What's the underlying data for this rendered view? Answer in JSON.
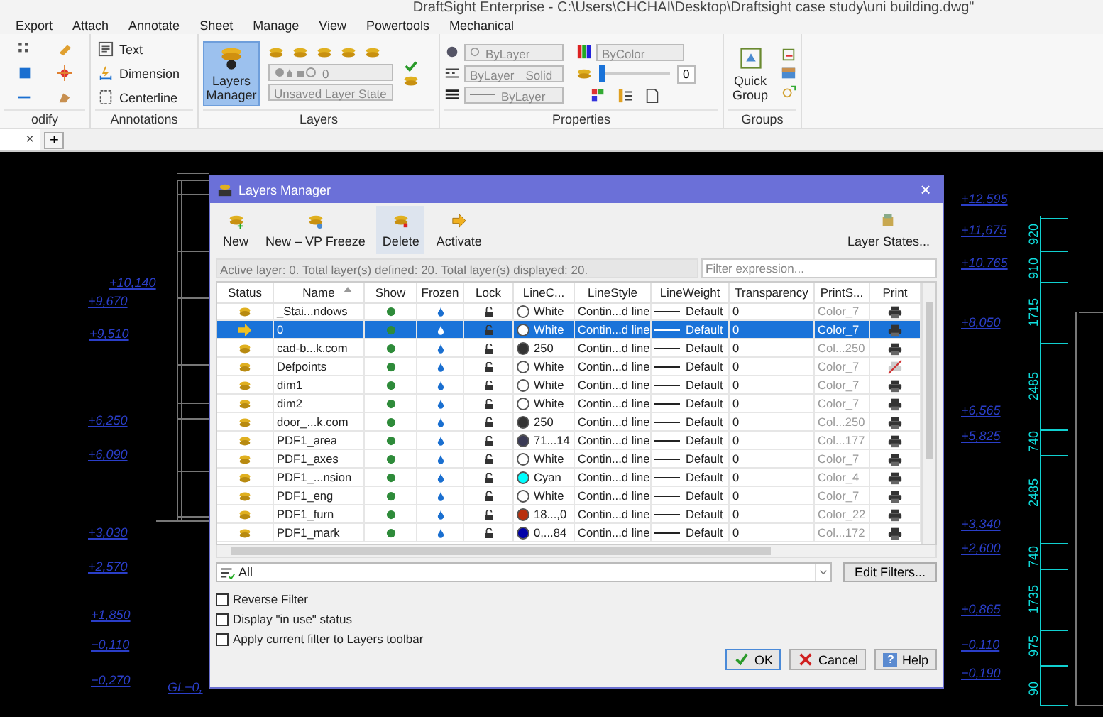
{
  "window": {
    "title": "DraftSight Enterprise - C:\\Users\\CHCHAI\\Desktop\\Draftsight case study\\uni building.dwg\""
  },
  "ribbon": {
    "tabs": [
      "Export",
      "Attach",
      "Annotate",
      "Sheet",
      "Manage",
      "View",
      "Powertools",
      "Mechanical"
    ],
    "modify": {
      "label": "odify"
    },
    "annotations": {
      "label": "Annotations",
      "items": [
        "Text",
        "Dimension",
        "Centerline"
      ]
    },
    "layers": {
      "label": "Layers",
      "manager_button": {
        "label": "Layers Manager",
        "active": true
      },
      "layer_combo": "0",
      "state_combo": "Unsaved Layer State"
    },
    "properties": {
      "label": "Properties",
      "color_combo": "ByLayer",
      "linestyle_combo": [
        "ByLayer",
        "Solid"
      ],
      "lineweight_combo": "ByLayer",
      "plotstyle_combo": "ByColor",
      "transparency": {
        "level": 0,
        "value": "0"
      }
    },
    "groups": {
      "label": "Groups",
      "quick_group": "Quick Group"
    }
  },
  "document_tabs": {
    "close": "×",
    "new": "+"
  },
  "canvas_labels": [
    {
      "text": "+10,140",
      "kind": "elevation"
    },
    {
      "text": "+9,670",
      "kind": "elevation"
    },
    {
      "text": "+9,510",
      "kind": "elevation"
    },
    {
      "text": "+6,250",
      "kind": "elevation"
    },
    {
      "text": "+6,090",
      "kind": "elevation"
    },
    {
      "text": "+3,030",
      "kind": "elevation"
    },
    {
      "text": "+2,570",
      "kind": "elevation"
    },
    {
      "text": "+1,850",
      "kind": "elevation"
    },
    {
      "text": "−0,110",
      "kind": "elevation"
    },
    {
      "text": "−0,270",
      "kind": "elevation"
    },
    {
      "text": "GL−0,",
      "kind": "elevation"
    },
    {
      "text": "+12,595",
      "kind": "elevation"
    },
    {
      "text": "+11,675",
      "kind": "elevation"
    },
    {
      "text": "+10,765",
      "kind": "elevation"
    },
    {
      "text": "+8,050",
      "kind": "elevation"
    },
    {
      "text": "+6,565",
      "kind": "elevation"
    },
    {
      "text": "+5,825",
      "kind": "elevation"
    },
    {
      "text": "+3,340",
      "kind": "elevation"
    },
    {
      "text": "+2,600",
      "kind": "elevation"
    },
    {
      "text": "+0,865",
      "kind": "elevation"
    },
    {
      "text": "−0,110",
      "kind": "elevation"
    },
    {
      "text": "−0,190",
      "kind": "elevation"
    },
    {
      "text": "920",
      "kind": "dimension"
    },
    {
      "text": "910",
      "kind": "dimension"
    },
    {
      "text": "1715",
      "kind": "dimension"
    },
    {
      "text": "2485",
      "kind": "dimension"
    },
    {
      "text": "740",
      "kind": "dimension"
    },
    {
      "text": "2485",
      "kind": "dimension"
    },
    {
      "text": "740",
      "kind": "dimension"
    },
    {
      "text": "1735",
      "kind": "dimension"
    },
    {
      "text": "975",
      "kind": "dimension"
    },
    {
      "text": "90",
      "kind": "dimension"
    }
  ],
  "dialog": {
    "title": "Layers Manager",
    "close": "×",
    "toolbar": [
      {
        "label": "New",
        "hovered": false
      },
      {
        "label": "New – VP Freeze",
        "hovered": false
      },
      {
        "label": "Delete",
        "hovered": true
      },
      {
        "label": "Activate",
        "hovered": false
      }
    ],
    "layer_states_button": "Layer States...",
    "info": "Active layer: 0. Total layer(s) defined: 20. Total layer(s) displayed: 20.",
    "filter": {
      "placeholder": "Filter expression..."
    },
    "columns": [
      "Status",
      "Name",
      "Show",
      "Frozen",
      "Lock",
      "LineC...",
      "LineStyle",
      "LineWeight",
      "Transparency",
      "PrintS...",
      "Print"
    ],
    "rows": [
      {
        "name": "_Stai...ndows",
        "current": false,
        "selected": false,
        "on": true,
        "color_name": "White",
        "color": "#ffffff",
        "linestyle": "Contin...d line",
        "lineweight": "Default",
        "transparency": "0",
        "printstyle": "Color_7",
        "plot": true
      },
      {
        "name": "0",
        "current": true,
        "selected": true,
        "on": true,
        "color_name": "White",
        "color": "#ffffff",
        "linestyle": "Contin...d line",
        "lineweight": "Default",
        "transparency": "0",
        "printstyle": "Color_7",
        "plot": true
      },
      {
        "name": "cad-b...k.com",
        "current": false,
        "selected": false,
        "on": true,
        "color_name": "250",
        "color": "#333333",
        "linestyle": "Contin...d line",
        "lineweight": "Default",
        "transparency": "0",
        "printstyle": "Col...250",
        "plot": true
      },
      {
        "name": "Defpoints",
        "current": false,
        "selected": false,
        "on": true,
        "color_name": "White",
        "color": "#ffffff",
        "linestyle": "Contin...d line",
        "lineweight": "Default",
        "transparency": "0",
        "printstyle": "Color_7",
        "plot": false
      },
      {
        "name": "dim1",
        "current": false,
        "selected": false,
        "on": true,
        "color_name": "White",
        "color": "#ffffff",
        "linestyle": "Contin...d line",
        "lineweight": "Default",
        "transparency": "0",
        "printstyle": "Color_7",
        "plot": true
      },
      {
        "name": "dim2",
        "current": false,
        "selected": false,
        "on": true,
        "color_name": "White",
        "color": "#ffffff",
        "linestyle": "Contin...d line",
        "lineweight": "Default",
        "transparency": "0",
        "printstyle": "Color_7",
        "plot": true
      },
      {
        "name": "door_...k.com",
        "current": false,
        "selected": false,
        "on": true,
        "color_name": "250",
        "color": "#333333",
        "linestyle": "Contin...d line",
        "lineweight": "Default",
        "transparency": "0",
        "printstyle": "Col...250",
        "plot": true
      },
      {
        "name": "PDF1_area",
        "current": false,
        "selected": false,
        "on": true,
        "color_name": "71...14",
        "color": "#3a3a55",
        "linestyle": "Contin...d line",
        "lineweight": "Default",
        "transparency": "0",
        "printstyle": "Col...177",
        "plot": true
      },
      {
        "name": "PDF1_axes",
        "current": false,
        "selected": false,
        "on": true,
        "color_name": "White",
        "color": "#ffffff",
        "linestyle": "Contin...d line",
        "lineweight": "Default",
        "transparency": "0",
        "printstyle": "Color_7",
        "plot": true
      },
      {
        "name": "PDF1_...nsion",
        "current": false,
        "selected": false,
        "on": true,
        "color_name": "Cyan",
        "color": "#00ffff",
        "linestyle": "Contin...d line",
        "lineweight": "Default",
        "transparency": "0",
        "printstyle": "Color_4",
        "plot": true
      },
      {
        "name": "PDF1_eng",
        "current": false,
        "selected": false,
        "on": true,
        "color_name": "White",
        "color": "#ffffff",
        "linestyle": "Contin...d line",
        "lineweight": "Default",
        "transparency": "0",
        "printstyle": "Color_7",
        "plot": true
      },
      {
        "name": "PDF1_furn",
        "current": false,
        "selected": false,
        "on": true,
        "color_name": "18...,0",
        "color": "#b8300e",
        "linestyle": "Contin...d line",
        "lineweight": "Default",
        "transparency": "0",
        "printstyle": "Color_22",
        "plot": true
      },
      {
        "name": "PDF1_mark",
        "current": false,
        "selected": false,
        "on": true,
        "color_name": "0,...84",
        "color": "#0000a8",
        "linestyle": "Contin...d line",
        "lineweight": "Default",
        "transparency": "0",
        "printstyle": "Col...172",
        "plot": true
      }
    ],
    "filter_combo": "All",
    "edit_filters": "Edit Filters...",
    "options": [
      {
        "label": "Reverse Filter",
        "checked": false
      },
      {
        "label": "Display \"in use\" status",
        "checked": false
      },
      {
        "label": "Apply current filter to Layers toolbar",
        "checked": false
      }
    ],
    "buttons": [
      {
        "kind": "ok",
        "label": "OK"
      },
      {
        "kind": "cancel",
        "label": "Cancel"
      },
      {
        "kind": "help",
        "label": "Help",
        "glyph": "?"
      }
    ]
  }
}
